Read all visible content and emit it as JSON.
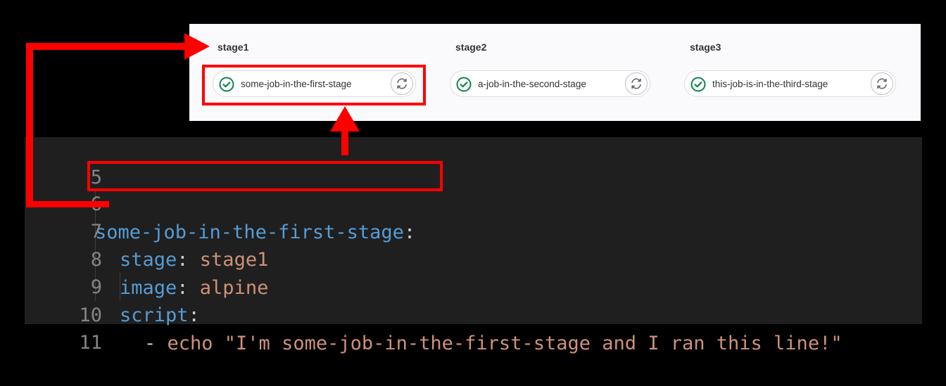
{
  "pipeline": {
    "stages": [
      {
        "title": "stage1",
        "job": {
          "name": "some-job-in-the-first-stage",
          "status": "passed",
          "status_icon": "check-circle-icon",
          "action_icon": "retry-icon"
        }
      },
      {
        "title": "stage2",
        "job": {
          "name": "a-job-in-the-second-stage",
          "status": "passed",
          "status_icon": "check-circle-icon",
          "action_icon": "retry-icon"
        }
      },
      {
        "title": "stage3",
        "job": {
          "name": "this-job-is-in-the-third-stage",
          "status": "passed",
          "status_icon": "check-circle-icon",
          "action_icon": "retry-icon"
        }
      }
    ],
    "colors": {
      "success": "#108548",
      "panel_bg": "#fafafc"
    }
  },
  "editor": {
    "lines": [
      {
        "number": "5",
        "indent": "",
        "key": "",
        "sep": "",
        "value": ""
      },
      {
        "number": "6",
        "indent": "",
        "key": "some-job-in-the-first-stage",
        "sep": ":",
        "value": ""
      },
      {
        "number": "7",
        "indent": "  ",
        "key": "stage",
        "sep": ": ",
        "value": "stage1"
      },
      {
        "number": "8",
        "indent": "  ",
        "key": "image",
        "sep": ": ",
        "value": "alpine"
      },
      {
        "number": "9",
        "indent": "  ",
        "key": "script",
        "sep": ":",
        "value": ""
      },
      {
        "number": "10",
        "indent": "    ",
        "key": "",
        "sep": "- ",
        "value": "echo \"I'm some-job-in-the-first-stage and I ran this line!\""
      },
      {
        "number": "11",
        "indent": "",
        "key": "",
        "sep": "",
        "value": ""
      }
    ],
    "colors": {
      "background": "#1f1f1f",
      "key": "#569cd6",
      "string": "#ce9178",
      "line_number": "#858585"
    }
  },
  "annotations": {
    "color": "#ff0000",
    "items": [
      "highlight-job-definition",
      "highlight-job-pill",
      "arrow-up-to-job",
      "arrow-stage-to-stage-title"
    ]
  }
}
